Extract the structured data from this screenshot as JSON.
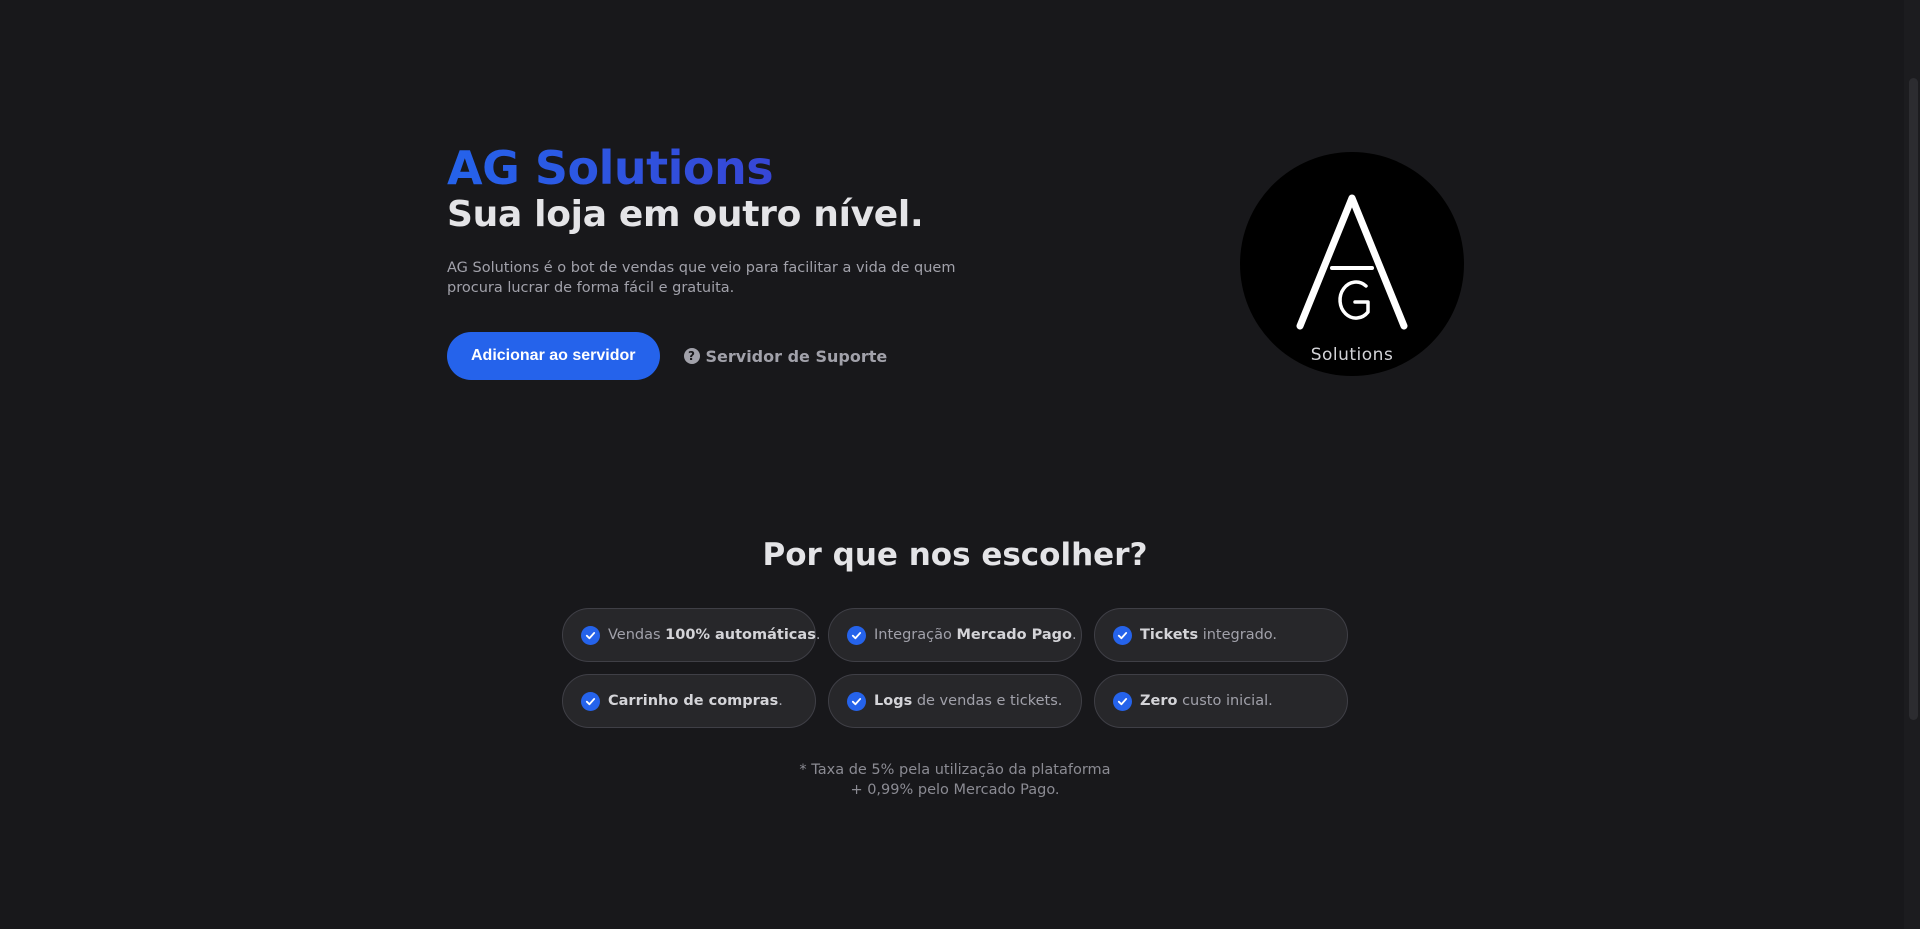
{
  "hero": {
    "brand": "AG Solutions",
    "tagline": "Sua loja em outro nível.",
    "description": "AG Solutions é o bot de vendas que veio para facilitar a vida de quem procura lucrar de forma fácil e gratuita.",
    "primary_button": "Adicionar ao servidor",
    "secondary_link": "Servidor de Suporte",
    "secondary_icon": "help-circle-icon"
  },
  "logo": {
    "caption": "Solutions",
    "letters": "AG"
  },
  "features": {
    "title": "Por que nos escolher?",
    "items": [
      {
        "before": "Vendas ",
        "bold": "100% automáticas",
        "after": "."
      },
      {
        "before": "Integração ",
        "bold": "Mercado Pago",
        "after": "."
      },
      {
        "before": "",
        "bold": "Tickets",
        "after": " integrado."
      },
      {
        "before": "",
        "bold": "Carrinho de compras",
        "after": "."
      },
      {
        "before": "",
        "bold": "Logs",
        "after": " de vendas e tickets."
      },
      {
        "before": "",
        "bold": "Zero",
        "after": " custo inicial."
      }
    ],
    "icon": "check-circle-icon"
  },
  "footnote": {
    "line1": "* Taxa de 5% pela utilização da plataforma",
    "line2": "+ 0,99% pelo Mercado Pago."
  },
  "colors": {
    "background": "#18181b",
    "accent": "#2563eb",
    "pill_background": "#27272a"
  }
}
